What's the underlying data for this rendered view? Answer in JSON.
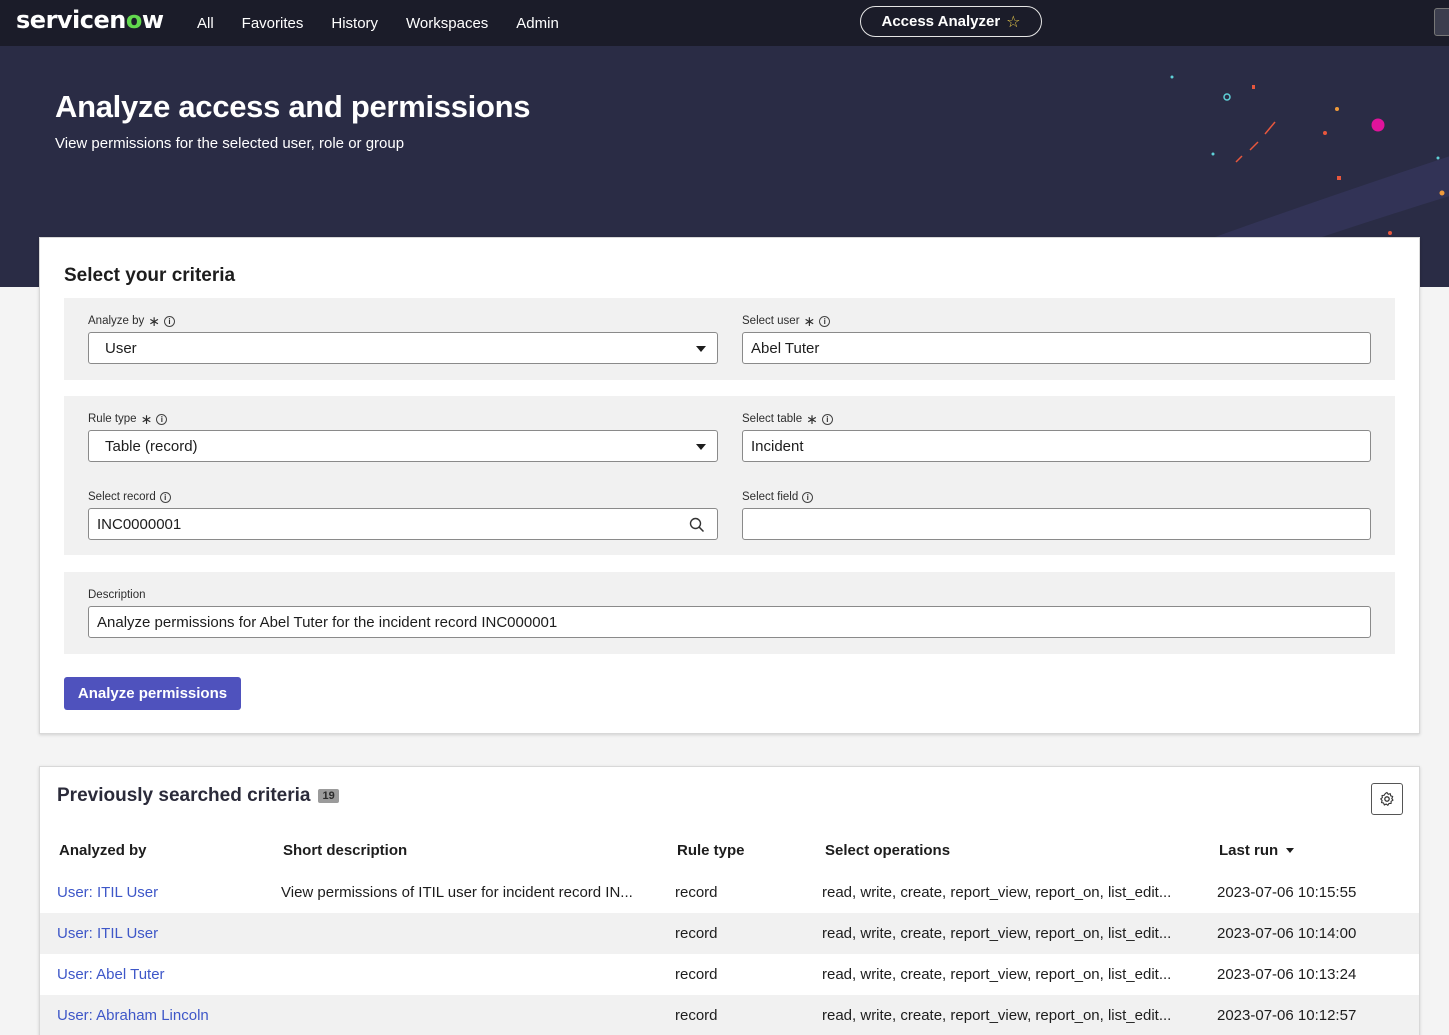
{
  "nav": {
    "logo_prefix": "servicen",
    "logo_o": "o",
    "logo_suffix": "w",
    "items": [
      "All",
      "Favorites",
      "History",
      "Workspaces",
      "Admin"
    ],
    "app_pill": "Access Analyzer",
    "star_icon": "☆"
  },
  "hero": {
    "title": "Analyze access and permissions",
    "subtitle": "View permissions for the selected user, role or group"
  },
  "criteria": {
    "title": "Select your criteria",
    "analyze_by": {
      "label": "Analyze by",
      "value": "User"
    },
    "select_user": {
      "label": "Select user",
      "value": "Abel Tuter"
    },
    "rule_type": {
      "label": "Rule type",
      "value": "Table (record)"
    },
    "select_table": {
      "label": "Select table",
      "value": "Incident"
    },
    "select_record": {
      "label": "Select record",
      "value": "INC0000001"
    },
    "select_field": {
      "label": "Select field",
      "value": ""
    },
    "description": {
      "label": "Description",
      "value": "Analyze permissions for Abel Tuter for the incident record INC000001"
    },
    "required_mark": "∗",
    "info_mark": "i",
    "analyze_button": "Analyze permissions"
  },
  "previous": {
    "title": "Previously searched criteria",
    "count": "19",
    "columns": {
      "analyzed_by": "Analyzed by",
      "short_description": "Short description",
      "rule_type": "Rule type",
      "select_operations": "Select operations",
      "last_run": "Last run"
    },
    "rows": [
      {
        "analyzed_by": "User: ITIL User",
        "short_description": "View permissions of ITIL user for incident record IN...",
        "rule_type": "record",
        "operations": "read, write, create, report_view, report_on, list_edit...",
        "last_run": "2023-07-06 10:15:55"
      },
      {
        "analyzed_by": "User: ITIL User",
        "short_description": "",
        "rule_type": "record",
        "operations": "read, write, create, report_view, report_on, list_edit...",
        "last_run": "2023-07-06 10:14:00"
      },
      {
        "analyzed_by": "User: Abel Tuter",
        "short_description": "",
        "rule_type": "record",
        "operations": "read, write, create, report_view, report_on, list_edit...",
        "last_run": "2023-07-06 10:13:24"
      },
      {
        "analyzed_by": "User: Abraham Lincoln",
        "short_description": "",
        "rule_type": "record",
        "operations": "read, write, create, report_view, report_on, list_edit...",
        "last_run": "2023-07-06 10:12:57"
      }
    ]
  },
  "colors": {
    "nav_bg": "#1b1c29",
    "hero_bg": "#2a2c45",
    "primary": "#4f52bd",
    "link": "#3e57c8",
    "logo_accent": "#62d84e"
  }
}
